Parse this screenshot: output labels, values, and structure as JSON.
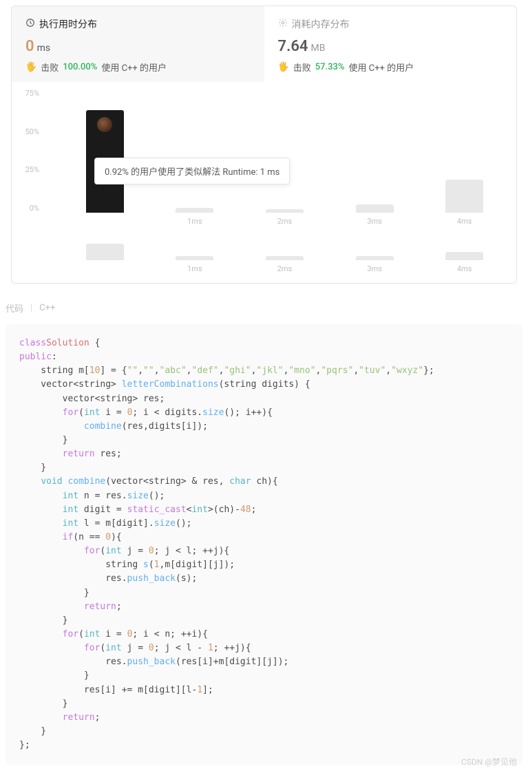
{
  "stats": {
    "runtime": {
      "title": "执行用时分布",
      "value": "0",
      "unit": "ms",
      "beat_prefix": "击败",
      "beat_percent": "100.00%",
      "beat_suffix": "使用 C++ 的用户"
    },
    "memory": {
      "title": "消耗内存分布",
      "value": "7.64",
      "unit": "MB",
      "beat_prefix": "击败",
      "beat_percent": "57.33%",
      "beat_suffix": "使用 C++ 的用户"
    }
  },
  "chart_data": {
    "type": "bar",
    "y_ticks": [
      "75%",
      "50%",
      "25%",
      "0%"
    ],
    "bars": [
      {
        "label": "",
        "value": 62,
        "highlighted": true
      },
      {
        "label": "1ms",
        "value": 3
      },
      {
        "label": "2ms",
        "value": 2
      },
      {
        "label": "3ms",
        "value": 5
      },
      {
        "label": "4ms",
        "value": 20
      }
    ],
    "secondary_bars": [
      {
        "label": "",
        "value": 24
      },
      {
        "label": "1ms",
        "value": 6
      },
      {
        "label": "2ms",
        "value": 6
      },
      {
        "label": "3ms",
        "value": 6
      },
      {
        "label": "4ms",
        "value": 12
      }
    ],
    "tooltip": "0.92% 的用户使用了类似解法 Runtime: 1 ms"
  },
  "code_header": {
    "label": "代码",
    "lang": "C++"
  },
  "code_tokens": [
    [
      [
        "kw",
        "class"
      ],
      [
        "",
        ""
      ],
      [
        "cls",
        "Solution"
      ],
      [
        "",
        " {"
      ]
    ],
    [
      [
        "kw",
        "public"
      ],
      [
        "",
        ":"
      ]
    ],
    [
      [
        "",
        "    string m["
      ],
      [
        "num",
        "10"
      ],
      [
        "",
        "] = {"
      ],
      [
        "str",
        "\"\""
      ],
      [
        "",
        ","
      ],
      [
        "str",
        "\"\""
      ],
      [
        "",
        ","
      ],
      [
        "str",
        "\"abc\""
      ],
      [
        "",
        ","
      ],
      [
        "str",
        "\"def\""
      ],
      [
        "",
        ","
      ],
      [
        "str",
        "\"ghi\""
      ],
      [
        "",
        ","
      ],
      [
        "str",
        "\"jkl\""
      ],
      [
        "",
        ","
      ],
      [
        "str",
        "\"mno\""
      ],
      [
        "",
        ","
      ],
      [
        "str",
        "\"pqrs\""
      ],
      [
        "",
        ","
      ],
      [
        "str",
        "\"tuv\""
      ],
      [
        "",
        ","
      ],
      [
        "str",
        "\"wxyz\""
      ],
      [
        "",
        "};"
      ]
    ],
    [
      [
        "",
        "    vector<string> "
      ],
      [
        "fn",
        "letterCombinations"
      ],
      [
        "",
        "(string digits) {"
      ]
    ],
    [
      [
        "",
        "        vector<string> res;"
      ]
    ],
    [
      [
        "",
        "        "
      ],
      [
        "kw",
        "for"
      ],
      [
        "",
        "("
      ],
      [
        "type",
        "int"
      ],
      [
        "",
        " i = "
      ],
      [
        "num",
        "0"
      ],
      [
        "",
        "; i < digits."
      ],
      [
        "fn",
        "size"
      ],
      [
        "",
        "(); i++){"
      ]
    ],
    [
      [
        "",
        "            "
      ],
      [
        "fn",
        "combine"
      ],
      [
        "",
        "(res,digits[i]);"
      ]
    ],
    [
      [
        "",
        "        }"
      ]
    ],
    [
      [
        "",
        "        "
      ],
      [
        "kw",
        "return"
      ],
      [
        "",
        " res;"
      ]
    ],
    [
      [
        "",
        "    }"
      ]
    ],
    [
      [
        "",
        "    "
      ],
      [
        "type",
        "void"
      ],
      [
        "",
        " "
      ],
      [
        "fn",
        "combine"
      ],
      [
        "",
        "(vector<string> & res, "
      ],
      [
        "type",
        "char"
      ],
      [
        "",
        " ch){"
      ]
    ],
    [
      [
        "",
        "        "
      ],
      [
        "type",
        "int"
      ],
      [
        "",
        " n = res."
      ],
      [
        "fn",
        "size"
      ],
      [
        "",
        "();"
      ]
    ],
    [
      [
        "",
        "        "
      ],
      [
        "type",
        "int"
      ],
      [
        "",
        " digit = "
      ],
      [
        "kw",
        "static_cast"
      ],
      [
        "",
        "<"
      ],
      [
        "type",
        "int"
      ],
      [
        "",
        ">(ch)-"
      ],
      [
        "num",
        "48"
      ],
      [
        "",
        ";"
      ]
    ],
    [
      [
        "",
        "        "
      ],
      [
        "type",
        "int"
      ],
      [
        "",
        " l = m[digit]."
      ],
      [
        "fn",
        "size"
      ],
      [
        "",
        "();"
      ]
    ],
    [
      [
        "",
        "        "
      ],
      [
        "kw",
        "if"
      ],
      [
        "",
        "(n == "
      ],
      [
        "num",
        "0"
      ],
      [
        "",
        "){"
      ]
    ],
    [
      [
        "",
        "            "
      ],
      [
        "kw",
        "for"
      ],
      [
        "",
        "("
      ],
      [
        "type",
        "int"
      ],
      [
        "",
        " j = "
      ],
      [
        "num",
        "0"
      ],
      [
        "",
        "; j < l; ++j){"
      ]
    ],
    [
      [
        "",
        "                string "
      ],
      [
        "fn",
        "s"
      ],
      [
        "",
        "("
      ],
      [
        "num",
        "1"
      ],
      [
        "",
        ",m[digit][j]);"
      ]
    ],
    [
      [
        "",
        "                res."
      ],
      [
        "fn",
        "push_back"
      ],
      [
        "",
        "(s);"
      ]
    ],
    [
      [
        "",
        "            }"
      ]
    ],
    [
      [
        "",
        "            "
      ],
      [
        "kw",
        "return"
      ],
      [
        "",
        ";"
      ]
    ],
    [
      [
        "",
        "        }"
      ]
    ],
    [
      [
        "",
        "        "
      ],
      [
        "kw",
        "for"
      ],
      [
        "",
        "("
      ],
      [
        "type",
        "int"
      ],
      [
        "",
        " i = "
      ],
      [
        "num",
        "0"
      ],
      [
        "",
        "; i < n; ++i){"
      ]
    ],
    [
      [
        "",
        "            "
      ],
      [
        "kw",
        "for"
      ],
      [
        "",
        "("
      ],
      [
        "type",
        "int"
      ],
      [
        "",
        " j = "
      ],
      [
        "num",
        "0"
      ],
      [
        "",
        "; j < l - "
      ],
      [
        "num",
        "1"
      ],
      [
        "",
        "; ++j){"
      ]
    ],
    [
      [
        "",
        "                res."
      ],
      [
        "fn",
        "push_back"
      ],
      [
        "",
        "(res[i]+m[digit][j]);"
      ]
    ],
    [
      [
        "",
        "            }"
      ]
    ],
    [
      [
        "",
        "            res[i] += m[digit][l-"
      ],
      [
        "num",
        "1"
      ],
      [
        "",
        "];"
      ]
    ],
    [
      [
        "",
        "        }"
      ]
    ],
    [
      [
        "",
        "        "
      ],
      [
        "kw",
        "return"
      ],
      [
        "",
        ";"
      ]
    ],
    [
      [
        "",
        "    }"
      ]
    ],
    [
      [
        "",
        "};"
      ]
    ]
  ],
  "watermark": "CSDN @梦见他"
}
